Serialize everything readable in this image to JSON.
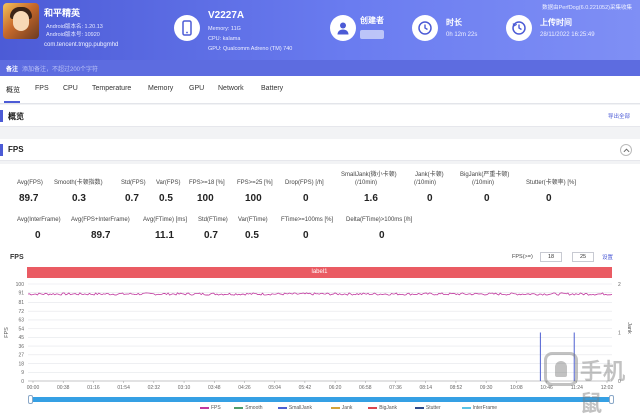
{
  "app": {
    "name": "和平精英",
    "android_version": "Android版本名: 1.20.13",
    "android_code": "Android版本号: 10920",
    "package": "com.tencent.tmgp.pubgmhd"
  },
  "device": {
    "name": "V2227A",
    "memory": "Memory: 11G",
    "cpu": "CPU: kalama",
    "gpu": "GPU: Qualcomm Adreno (TM) 740"
  },
  "creator": {
    "label": "创建者"
  },
  "duration": {
    "label": "时长",
    "value": "0h 12m 22s"
  },
  "upload": {
    "label": "上传时间",
    "value": "28/11/2022 16:25:49"
  },
  "top_note": "数据由PerfDog(6.0.221052)采集收集",
  "note": {
    "label": "备注",
    "placeholder": "添加备注，不超过200个字符"
  },
  "tabs": [
    "概览",
    "FPS",
    "CPU",
    "Temperature",
    "Memory",
    "GPU",
    "Network",
    "Battery"
  ],
  "overview": {
    "title": "概览",
    "export_label": "导出全部"
  },
  "fps_section": {
    "title": "FPS"
  },
  "stats_row1": [
    {
      "label": "Avg(FPS)",
      "value": "89.7"
    },
    {
      "label": "Smooth(卡顿指数)",
      "value": "0.3"
    },
    {
      "label": "Std(FPS)",
      "value": "0.7"
    },
    {
      "label": "Var(FPS)",
      "value": "0.5"
    },
    {
      "label": "FPS>=18 [%]",
      "value": "100"
    },
    {
      "label": "FPS>=25 [%]",
      "value": "100"
    },
    {
      "label": "Drop(FPS) [/h]",
      "value": "0"
    },
    {
      "label": "SmallJank(微小卡顿)",
      "label2": "(/10min)",
      "value": "1.6"
    },
    {
      "label": "Jank(卡顿)",
      "label2": "(/10min)",
      "value": "0"
    },
    {
      "label": "BigJank(严重卡顿)",
      "label2": "(/10min)",
      "value": "0"
    },
    {
      "label": "Stutter(卡顿率) [%]",
      "value": "0"
    }
  ],
  "stats_row2": [
    {
      "label": "Avg(InterFrame)",
      "value": "0"
    },
    {
      "label": "Avg(FPS+InterFrame)",
      "value": "89.7"
    },
    {
      "label": "Avg(FTime) [ms]",
      "value": "11.1"
    },
    {
      "label": "Std(FTime)",
      "value": "0.7"
    },
    {
      "label": "Var(FTime)",
      "value": "0.5"
    },
    {
      "label": "FTime>=100ms [%]",
      "value": "0"
    },
    {
      "label": "Delta(FTime)>100ms [/h]",
      "value": "0"
    }
  ],
  "chart_controls": {
    "title": "FPS",
    "filter_label": "FPS(>=)",
    "filter_values": [
      "18",
      "25"
    ],
    "set_label": "设置",
    "band_label": "label1"
  },
  "chart_data": {
    "type": "line",
    "ylabel": "FPS",
    "y2label": "Jank",
    "ylim": [
      0,
      100
    ],
    "yticks": [
      0,
      9,
      18,
      27,
      36,
      45,
      54,
      63,
      72,
      81,
      91,
      100
    ],
    "y2lim": [
      0,
      2
    ],
    "y2ticks": [
      0,
      1,
      2
    ],
    "xticks": [
      "00:00",
      "00:38",
      "01:16",
      "01:54",
      "02:32",
      "03:10",
      "03:48",
      "04:26",
      "05:04",
      "05:42",
      "06:20",
      "06:58",
      "07:36",
      "08:14",
      "08:52",
      "09:30",
      "10:08",
      "10:46",
      "11:24",
      "12:02"
    ],
    "x_range_sec": [
      0,
      742
    ],
    "fps_level": 89.7,
    "small_jank_times_sec": [
      651,
      694
    ],
    "series": [
      {
        "name": "FPS",
        "color": "#c0399e"
      },
      {
        "name": "Smooth",
        "color": "#4f9d6b"
      },
      {
        "name": "SmallJank",
        "color": "#4d5fd1"
      },
      {
        "name": "Jank",
        "color": "#d4a33a"
      },
      {
        "name": "BigJank",
        "color": "#d9454e"
      },
      {
        "name": "Stutter",
        "color": "#2f4a8a"
      },
      {
        "name": "InterFrame",
        "color": "#5bc3e6"
      }
    ]
  }
}
